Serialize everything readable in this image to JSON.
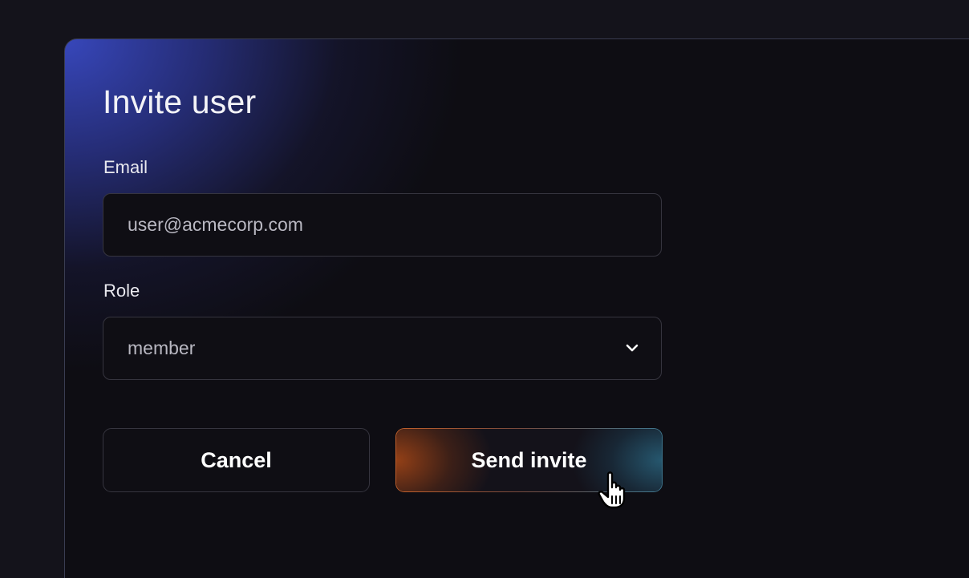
{
  "dialog": {
    "title": "Invite user"
  },
  "form": {
    "email": {
      "label": "Email",
      "value": "user@acmecorp.com"
    },
    "role": {
      "label": "Role",
      "selected": "member"
    }
  },
  "actions": {
    "cancel_label": "Cancel",
    "send_label": "Send invite"
  },
  "colors": {
    "background": "#14131b",
    "dialog": "#0e0d13",
    "accent_blue": "#3848be",
    "send_gradient_start": "#c2602b",
    "send_gradient_end": "#3e7790"
  },
  "icons": {
    "role_dropdown": "chevron-down-icon",
    "cursor": "hand-pointer-icon"
  }
}
